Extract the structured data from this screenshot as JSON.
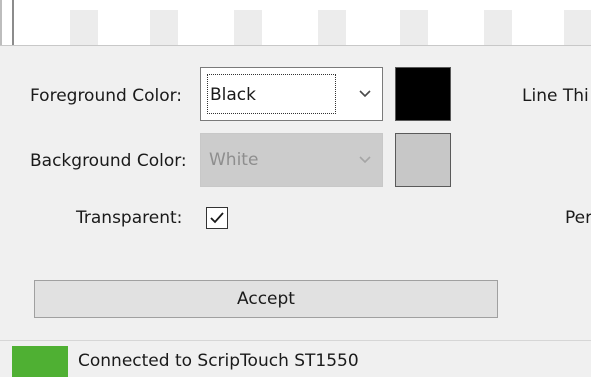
{
  "form": {
    "foreground": {
      "label": "Foreground Color:",
      "value": "Black",
      "swatch_color": "#000000"
    },
    "background": {
      "label": "Background Color:",
      "value": "White",
      "swatch_color": "#c7c7c7"
    },
    "transparent": {
      "label": "Transparent:",
      "checked": true
    },
    "line_thickness_label_partial": "Line Thi",
    "per_label_partial": "Per",
    "accept_label": "Accept"
  },
  "status": {
    "text": "Connected to ScripTouch ST1550",
    "indicator_color": "#4fb033"
  },
  "icons": {
    "dropdown": "chevron-down-icon",
    "check": "check-icon"
  }
}
